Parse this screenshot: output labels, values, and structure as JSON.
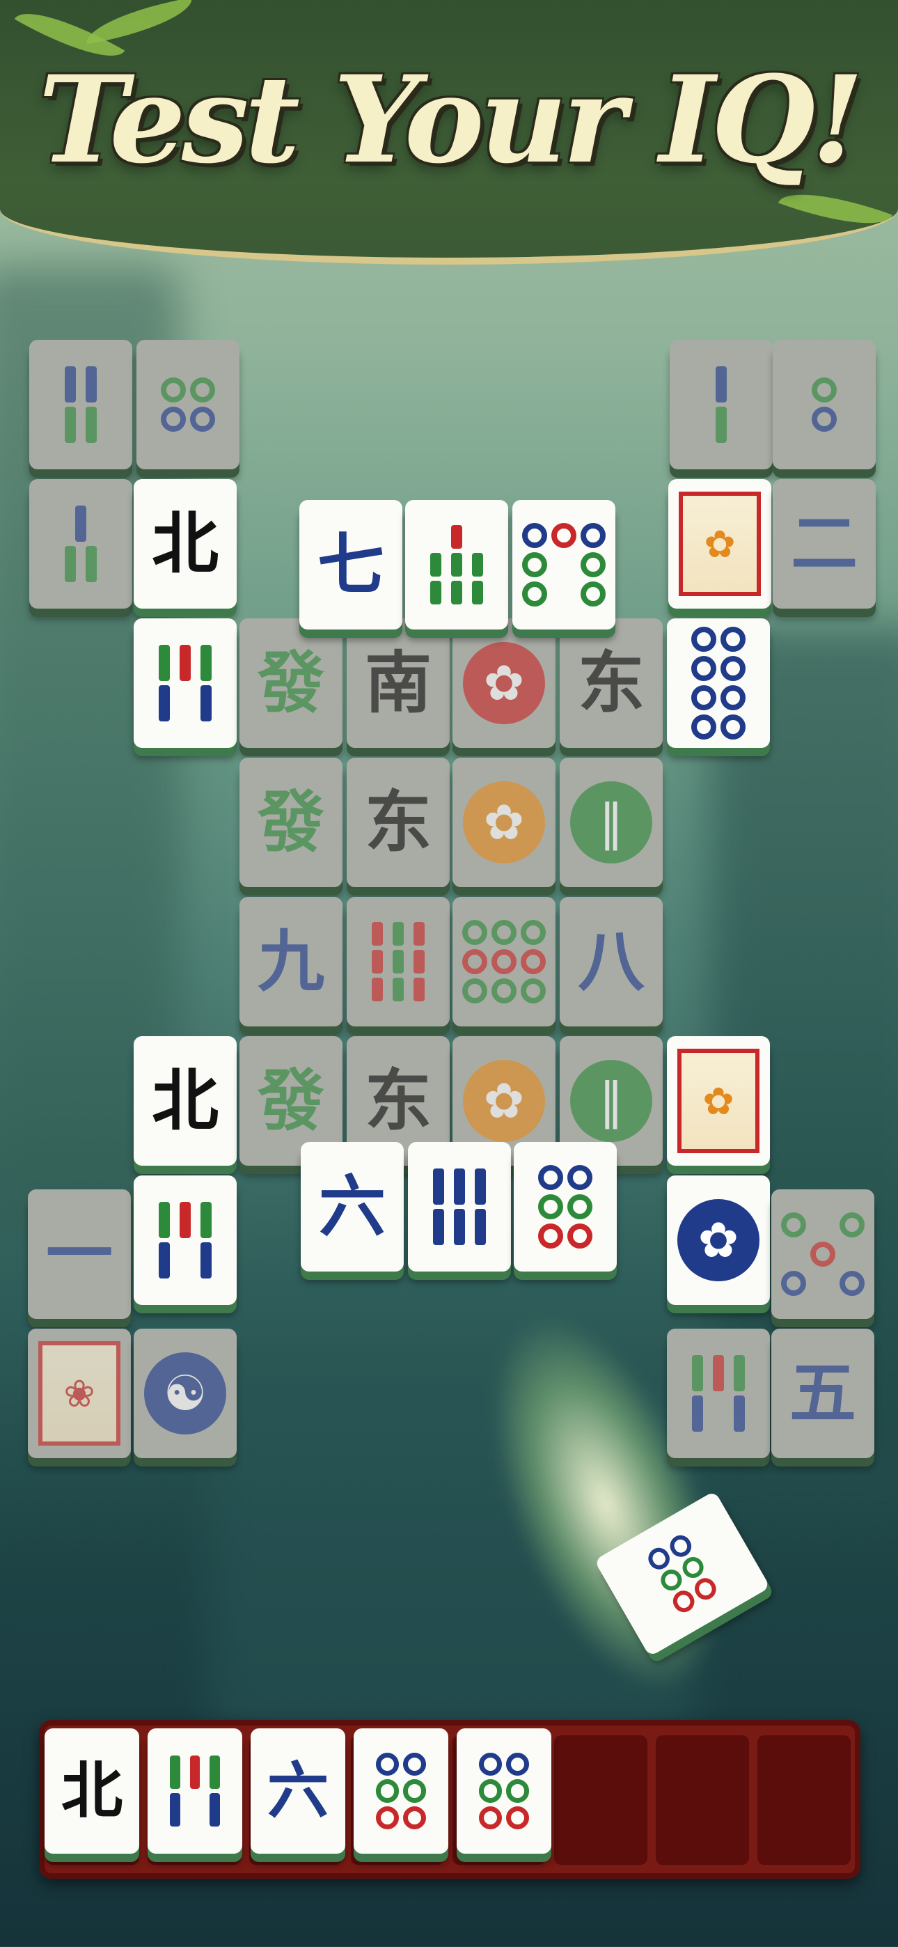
{
  "banner": {
    "title": "Test Your IQ!"
  },
  "colors": {
    "banner_green": "#3f5f37",
    "tile_face": "#fbfbf7",
    "tile_side": "#3e7a4c",
    "tray": "#7a1a14",
    "char_blue": "#1f3b8a",
    "char_green": "#2c8a3a",
    "char_red": "#c8282a"
  },
  "board": {
    "tiles": [
      {
        "id": "t1",
        "kind": "bamboo",
        "label": "4 bamboo",
        "dimmed": true
      },
      {
        "id": "t2",
        "kind": "dots",
        "label": "4 dots",
        "dimmed": true
      },
      {
        "id": "t3",
        "kind": "bamboo",
        "label": "2 bamboo",
        "dimmed": true
      },
      {
        "id": "t4",
        "kind": "dots",
        "label": "2 dots",
        "dimmed": true
      },
      {
        "id": "t5",
        "kind": "bamboo",
        "label": "3 bamboo",
        "dimmed": true
      },
      {
        "id": "t6",
        "kind": "char",
        "char": "北",
        "dimmed": false
      },
      {
        "id": "t7",
        "kind": "char",
        "char": "七",
        "dimmed": false
      },
      {
        "id": "t8",
        "kind": "bamboo",
        "label": "7 bamboo",
        "dimmed": false
      },
      {
        "id": "t9",
        "kind": "dots",
        "label": "7 dots",
        "dimmed": false
      },
      {
        "id": "t10",
        "kind": "flower",
        "label": "deer season tile",
        "dimmed": false
      },
      {
        "id": "t11",
        "kind": "char",
        "char": "二",
        "dimmed": true
      },
      {
        "id": "t12",
        "kind": "bamboo",
        "label": "5 bamboo",
        "dimmed": false
      },
      {
        "id": "t13",
        "kind": "char",
        "char": "發",
        "dimmed": true
      },
      {
        "id": "t14",
        "kind": "char",
        "char": "南",
        "dimmed": true
      },
      {
        "id": "t15",
        "kind": "flower",
        "label": "plum emblem",
        "dimmed": true
      },
      {
        "id": "t16",
        "kind": "char",
        "char": "东",
        "dimmed": true
      },
      {
        "id": "t17",
        "kind": "dots",
        "label": "8 dots",
        "dimmed": false
      },
      {
        "id": "t18",
        "kind": "char",
        "char": "發",
        "dimmed": true
      },
      {
        "id": "t19",
        "kind": "char",
        "char": "东",
        "dimmed": true
      },
      {
        "id": "t20",
        "kind": "flower",
        "label": "chrysanthemum emblem",
        "dimmed": true
      },
      {
        "id": "t21",
        "kind": "flower",
        "label": "bamboo emblem",
        "dimmed": true
      },
      {
        "id": "t22",
        "kind": "char",
        "char": "九",
        "dimmed": true
      },
      {
        "id": "t23",
        "kind": "bamboo",
        "label": "9 bamboo",
        "dimmed": true
      },
      {
        "id": "t24",
        "kind": "dots",
        "label": "9 dots",
        "dimmed": true
      },
      {
        "id": "t25",
        "kind": "char",
        "char": "八",
        "dimmed": true
      },
      {
        "id": "t26",
        "kind": "char",
        "char": "北",
        "dimmed": false
      },
      {
        "id": "t27",
        "kind": "char",
        "char": "發",
        "dimmed": true
      },
      {
        "id": "t28",
        "kind": "char",
        "char": "东",
        "dimmed": true
      },
      {
        "id": "t29",
        "kind": "flower",
        "label": "chrysanthemum emblem",
        "dimmed": true
      },
      {
        "id": "t30",
        "kind": "flower",
        "label": "bamboo emblem",
        "dimmed": true
      },
      {
        "id": "t31",
        "kind": "flower",
        "label": "deer season tile",
        "dimmed": false
      },
      {
        "id": "t32",
        "kind": "char",
        "char": "一",
        "dimmed": true
      },
      {
        "id": "t33",
        "kind": "bamboo",
        "label": "5 bamboo",
        "dimmed": false
      },
      {
        "id": "t34",
        "kind": "char",
        "char": "六",
        "dimmed": false
      },
      {
        "id": "t35",
        "kind": "bamboo",
        "label": "6 bamboo",
        "dimmed": false
      },
      {
        "id": "t36",
        "kind": "dots",
        "label": "6 dots",
        "dimmed": false
      },
      {
        "id": "t37",
        "kind": "flower",
        "label": "blue flower emblem",
        "dimmed": false
      },
      {
        "id": "t38",
        "kind": "dots",
        "label": "5 dots",
        "dimmed": true
      },
      {
        "id": "t39",
        "kind": "flower",
        "label": "crane picture tile",
        "dimmed": true
      },
      {
        "id": "t40",
        "kind": "flower",
        "label": "yin-yang emblem",
        "dimmed": true
      },
      {
        "id": "t41",
        "kind": "bamboo",
        "label": "5 bamboo",
        "dimmed": true
      },
      {
        "id": "t42",
        "kind": "char",
        "char": "五",
        "dimmed": true
      }
    ]
  },
  "flying_tile": {
    "kind": "dots",
    "label": "6 dots"
  },
  "tray": {
    "slots_total": 8,
    "tiles": [
      {
        "kind": "char",
        "char": "北"
      },
      {
        "kind": "bamboo",
        "label": "5 bamboo"
      },
      {
        "kind": "char",
        "char": "六"
      },
      {
        "kind": "dots",
        "label": "6 dots"
      },
      {
        "kind": "dots",
        "label": "6 dots"
      }
    ]
  }
}
